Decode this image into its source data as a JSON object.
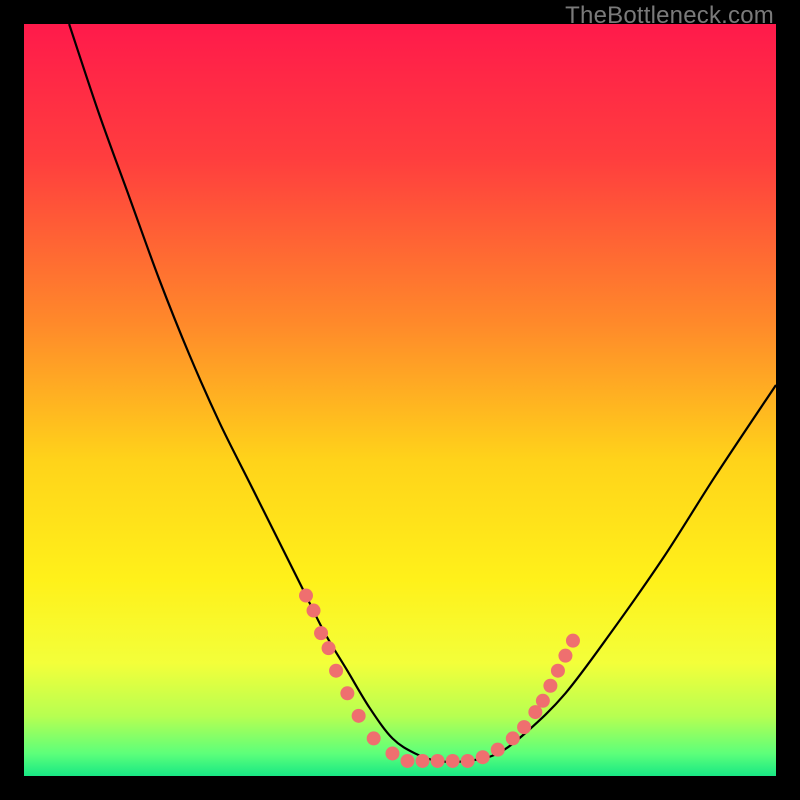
{
  "watermark": "TheBottleneck.com",
  "chart_data": {
    "type": "line",
    "title": "",
    "xlabel": "",
    "ylabel": "",
    "xlim": [
      0,
      100
    ],
    "ylim": [
      0,
      100
    ],
    "grid": false,
    "legend": false,
    "background_gradient": {
      "stops": [
        {
          "offset": 0.0,
          "color": "#ff1a4b"
        },
        {
          "offset": 0.18,
          "color": "#ff3e3e"
        },
        {
          "offset": 0.4,
          "color": "#ff8a2a"
        },
        {
          "offset": 0.58,
          "color": "#ffd31a"
        },
        {
          "offset": 0.74,
          "color": "#fff11a"
        },
        {
          "offset": 0.85,
          "color": "#f3ff3a"
        },
        {
          "offset": 0.92,
          "color": "#b7ff51"
        },
        {
          "offset": 0.97,
          "color": "#5dff7a"
        },
        {
          "offset": 1.0,
          "color": "#18e884"
        }
      ]
    },
    "series": [
      {
        "name": "bottleneck-curve",
        "x": [
          6,
          10,
          14,
          18,
          22,
          26,
          30,
          34,
          37,
          40,
          43,
          46,
          49,
          52,
          55,
          59,
          63,
          67,
          72,
          78,
          85,
          92,
          100
        ],
        "y": [
          100,
          88,
          77,
          66,
          56,
          47,
          39,
          31,
          25,
          19,
          14,
          9,
          5,
          3,
          2,
          2,
          3,
          6,
          11,
          19,
          29,
          40,
          52
        ]
      }
    ],
    "markers": {
      "name": "highlight-dots",
      "color": "#ef6f6f",
      "radius_px": 7,
      "points": [
        {
          "x": 37.5,
          "y": 24
        },
        {
          "x": 38.5,
          "y": 22
        },
        {
          "x": 39.5,
          "y": 19
        },
        {
          "x": 40.5,
          "y": 17
        },
        {
          "x": 41.5,
          "y": 14
        },
        {
          "x": 43.0,
          "y": 11
        },
        {
          "x": 44.5,
          "y": 8
        },
        {
          "x": 46.5,
          "y": 5
        },
        {
          "x": 49.0,
          "y": 3
        },
        {
          "x": 51.0,
          "y": 2
        },
        {
          "x": 53.0,
          "y": 2
        },
        {
          "x": 55.0,
          "y": 2
        },
        {
          "x": 57.0,
          "y": 2
        },
        {
          "x": 59.0,
          "y": 2
        },
        {
          "x": 61.0,
          "y": 2.5
        },
        {
          "x": 63.0,
          "y": 3.5
        },
        {
          "x": 65.0,
          "y": 5
        },
        {
          "x": 66.5,
          "y": 6.5
        },
        {
          "x": 68.0,
          "y": 8.5
        },
        {
          "x": 69.0,
          "y": 10
        },
        {
          "x": 70.0,
          "y": 12
        },
        {
          "x": 71.0,
          "y": 14
        },
        {
          "x": 72.0,
          "y": 16
        },
        {
          "x": 73.0,
          "y": 18
        }
      ]
    }
  }
}
